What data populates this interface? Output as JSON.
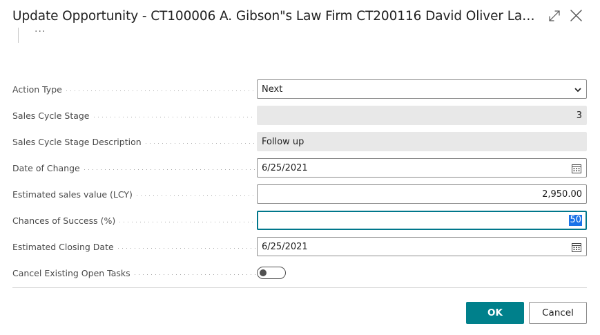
{
  "dialog": {
    "title": "Update Opportunity - CT100006 A. Gibson\"s Law Firm CT200116 David Oliver Law...",
    "more_label": "···"
  },
  "fields": {
    "action_type": {
      "label": "Action Type",
      "value": "Next"
    },
    "sales_cycle_stage": {
      "label": "Sales Cycle Stage",
      "value": "3"
    },
    "stage_description": {
      "label": "Sales Cycle Stage Description",
      "value": "Follow up"
    },
    "date_of_change": {
      "label": "Date of Change",
      "value": "6/25/2021"
    },
    "estimated_sales_value": {
      "label": "Estimated sales value (LCY)",
      "value": "2,950.00"
    },
    "chances_of_success": {
      "label": "Chances of Success (%)",
      "value": "50"
    },
    "estimated_closing_date": {
      "label": "Estimated Closing Date",
      "value": "6/25/2021"
    },
    "cancel_open_tasks": {
      "label": "Cancel Existing Open Tasks",
      "value": false
    }
  },
  "buttons": {
    "ok": "OK",
    "cancel": "Cancel"
  },
  "colors": {
    "accent": "#00808b",
    "focus_border": "#00778b",
    "selection": "#1a73e8"
  },
  "icons": {
    "expand": "expand-icon",
    "close": "close-icon",
    "dropdown": "chevron-down-icon",
    "calendar": "calendar-icon"
  }
}
